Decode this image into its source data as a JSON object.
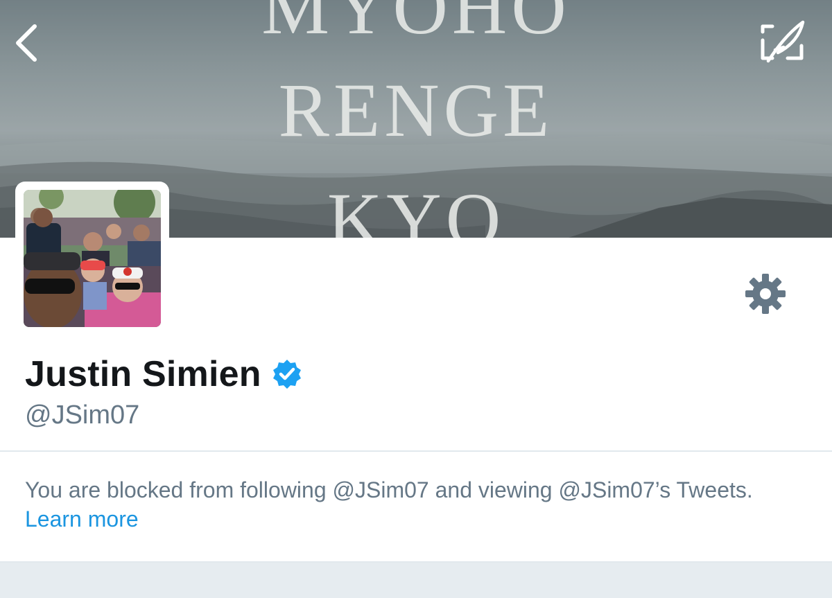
{
  "banner": {
    "lines": [
      "MYOHO",
      "RENGE",
      "KYO"
    ]
  },
  "header": {
    "back_icon": "chevron-left-icon",
    "compose_icon": "compose-quill-icon"
  },
  "profile": {
    "display_name": "Justin Simien",
    "handle": "@JSim07",
    "verified": true,
    "verified_icon": "verified-badge-icon",
    "settings_icon": "gear-icon"
  },
  "blocked_notice": {
    "text": "You are blocked from following @JSim07 and viewing @JSim07’s Tweets.",
    "link_label": "Learn more"
  },
  "colors": {
    "link_blue": "#1b95e0",
    "verified_blue": "#1da1f2",
    "secondary_text": "#657786",
    "primary_text": "#14171a",
    "divider": "#e1e8ed"
  }
}
